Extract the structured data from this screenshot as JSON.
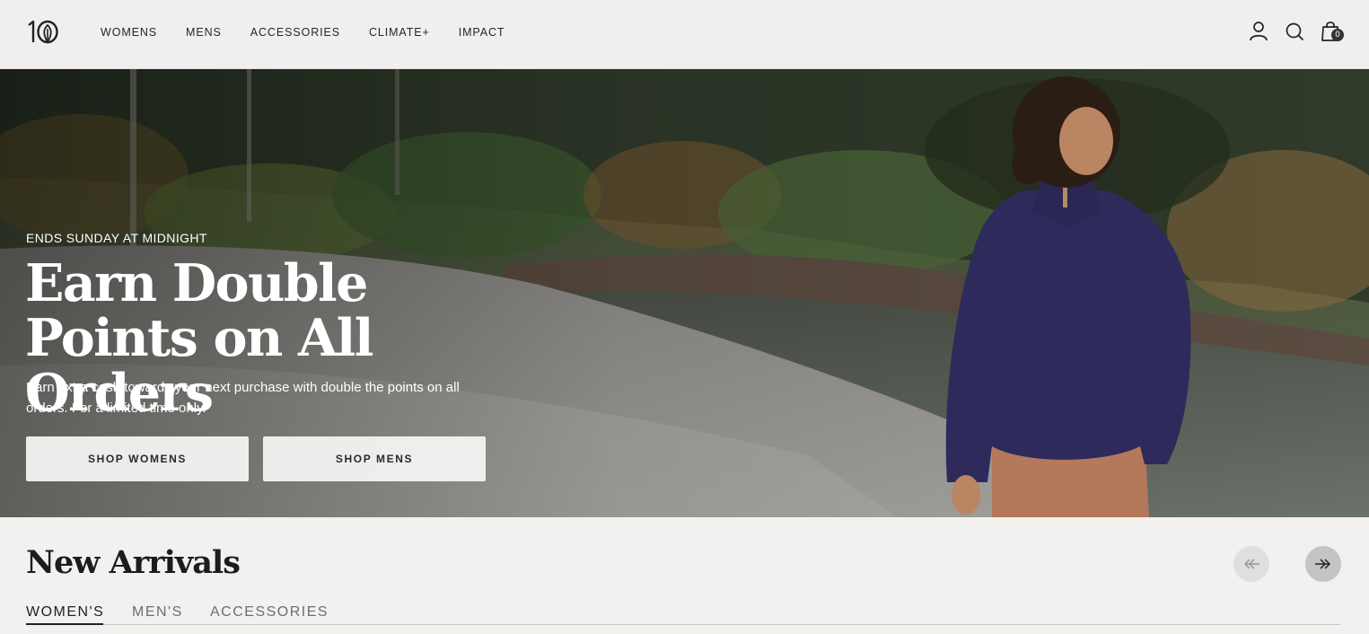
{
  "header": {
    "logo_text": "10",
    "nav": [
      "WOMENS",
      "MENS",
      "ACCESSORIES",
      "CLIMATE+",
      "IMPACT"
    ],
    "icons": [
      "account-icon",
      "search-icon",
      "cart-icon"
    ],
    "cart_count": "0"
  },
  "hero": {
    "eyebrow": "ENDS SUNDAY AT MIDNIGHT",
    "title": "Earn Double Points on All Orders",
    "body": "Earn extra cash towards your next purchase with double the points on all orders. For a limited time only.",
    "buttons": [
      "SHOP WOMENS",
      "SHOP MENS"
    ]
  },
  "new_arrivals": {
    "title": "New Arrivals",
    "tabs": [
      "WOMEN'S",
      "MEN'S",
      "ACCESSORIES"
    ],
    "active_tab": "WOMEN'S",
    "prev_icon": "arrow-left-icon",
    "next_icon": "arrow-right-icon"
  },
  "colors": {
    "header_bg": "#f0efee",
    "page_bg": "#f2f1f0",
    "sweater": "#2e2b5c",
    "pants": "#b3795a",
    "text_dark": "#1f1f1f"
  }
}
